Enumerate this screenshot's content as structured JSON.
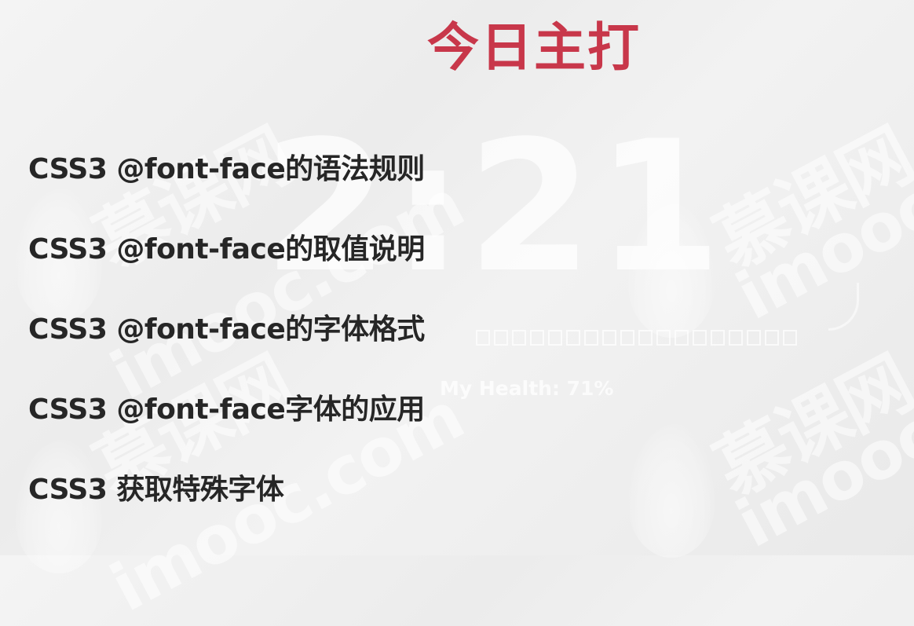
{
  "slide": {
    "title": "今日主打",
    "topics": [
      "CSS3 @font-face的语法规则",
      "CSS3 @font-face的取值说明",
      "CSS3 @font-face的字体格式",
      "CSS3 @font-face字体的应用",
      "CSS3 获取特殊字体"
    ]
  },
  "background": {
    "clock_text": "2:21",
    "health_text": "My Health: 71%",
    "watermark_cn": "慕课网",
    "watermark_en": "imooc.com",
    "watermark_en_short": "imooc"
  },
  "colors": {
    "title": "#c8374a",
    "text": "#262626",
    "background": "#eeeeee"
  }
}
